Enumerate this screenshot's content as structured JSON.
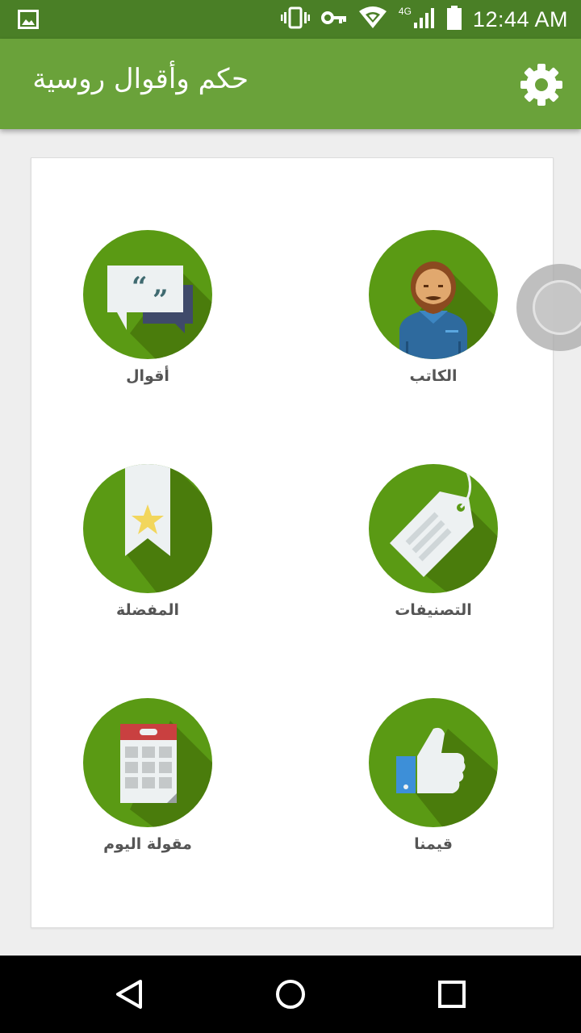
{
  "status_bar": {
    "time": "12:44 AM",
    "network": "4G",
    "icons": [
      "image-icon",
      "vibrate-icon",
      "vpn-key-icon",
      "wifi-icon",
      "signal-icon",
      "battery-icon"
    ]
  },
  "app_bar": {
    "title": "حكم وأقوال روسية",
    "settings_icon": "gear-icon",
    "color": "#6aa23a"
  },
  "menu": [
    {
      "label": "الكاتب",
      "icon": "author-icon"
    },
    {
      "label": "أقوال",
      "icon": "quotes-icon"
    },
    {
      "label": "التصنيفات",
      "icon": "tag-icon"
    },
    {
      "label": "المفضلة",
      "icon": "bookmark-star-icon"
    },
    {
      "label": "قيمنا",
      "icon": "thumbs-up-icon"
    },
    {
      "label": "مقولة اليوم",
      "icon": "calendar-icon"
    }
  ],
  "colors": {
    "circle": "#5a9a14",
    "circle_shadow": "#4a7c0c",
    "status_bar": "#4a7f26"
  },
  "nav_bar": {
    "icons": [
      "back-icon",
      "home-icon",
      "recents-icon"
    ]
  }
}
